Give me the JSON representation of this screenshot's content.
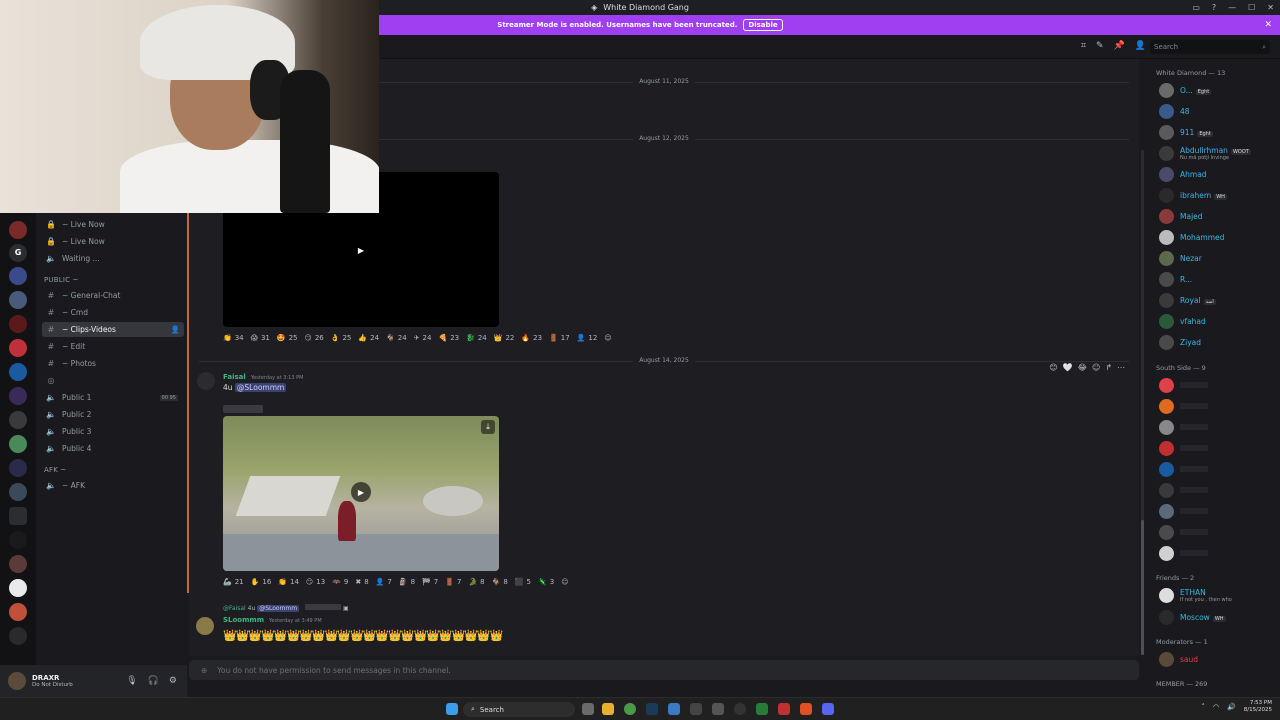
{
  "window": {
    "title": "White Diamond Gang"
  },
  "banner": {
    "text": "Streamer Mode is enabled. Usernames have been truncated.",
    "button": "Disable"
  },
  "search": {
    "placeholder": "Search"
  },
  "channels": {
    "items_top": [
      {
        "name": "~ Live Now",
        "icon": "lock-icon"
      },
      {
        "name": "~ Live Now",
        "icon": "lock-icon"
      },
      {
        "name": "Waiting ...",
        "icon": "speaker-icon"
      }
    ],
    "public_category": "PUBLIC ~",
    "public_items": [
      {
        "name": "~ General-Chat"
      },
      {
        "name": "~ Cmd"
      },
      {
        "name": "~ Clips-Videos",
        "active": true
      },
      {
        "name": "~ Edit"
      },
      {
        "name": "~ Photos"
      }
    ],
    "voice_items": [
      {
        "name": "Public 1",
        "count": "00",
        "limit": "95"
      },
      {
        "name": "Public 2"
      },
      {
        "name": "Public 3"
      },
      {
        "name": "Public 4"
      }
    ],
    "afk_category": "AFK ~",
    "afk_item": "~ AFK"
  },
  "user_panel": {
    "name": "DRAXR",
    "status": "Do Not Disturb"
  },
  "chat": {
    "dates": [
      "August 11, 2025",
      "August 12, 2025",
      "August 14, 2025"
    ],
    "reactions_1": [
      "34",
      "31",
      "25",
      "26",
      "25",
      "24",
      "24",
      "24",
      "23",
      "24",
      "22",
      "23",
      "17",
      "12"
    ],
    "message_1": {
      "author": "Faisal",
      "time": "Yesterday at 3:13 PM",
      "prefix": "4u",
      "mention": "@SLoommm"
    },
    "reactions_2": [
      "21",
      "16",
      "14",
      "13",
      "9",
      "8",
      "7",
      "8",
      "7",
      "7",
      "8",
      "8",
      "5",
      "3"
    ],
    "message_2": {
      "reply_author": "@Faisal",
      "reply_prefix": "4u",
      "reply_mention": "@SLoommm",
      "author": "SLoommm",
      "time": "Yesterday at 3:49 PM",
      "crowns": "👑👑👑👑👑👑👑👑👑👑👑👑👑👑👑👑👑👑👑👑👑👑"
    },
    "composer_placeholder": "You do not have permission to send messages in this channel."
  },
  "members": {
    "cat_white_diamond": "White Diamond — 13",
    "white_diamond": [
      {
        "name": "O...",
        "tag": "Eght"
      },
      {
        "name": "48"
      },
      {
        "name": "911",
        "tag": "Eght"
      },
      {
        "name": "Abdullrhman",
        "tag": "WOOT",
        "sub": "Nu mă potji Invinge"
      },
      {
        "name": "Ahmad"
      },
      {
        "name": "ibrahem",
        "tag": "WH"
      },
      {
        "name": "Majed"
      },
      {
        "name": "Mohammed"
      },
      {
        "name": "Nezar"
      },
      {
        "name": "R..."
      },
      {
        "name": "Royal",
        "tag": "اسد"
      },
      {
        "name": "vfahad"
      },
      {
        "name": "Ziyad"
      }
    ],
    "cat_south_side": "South Side — 9",
    "cat_friends": "Friends — 2",
    "friends": [
      {
        "name": "ETHAN",
        "sub": "If not you , then who"
      },
      {
        "name": "Moscow",
        "tag": "WH"
      }
    ],
    "cat_moderators": "Moderators — 1",
    "moderator": "saud",
    "cat_member": "MEMBER — 269"
  },
  "taskbar": {
    "search": "Search",
    "time": "7:53 PM",
    "date": "8/15/2025"
  },
  "colors": {
    "accent": "#a03ef2",
    "member_blue": "#3db5e6",
    "author_green": "#43b581"
  }
}
